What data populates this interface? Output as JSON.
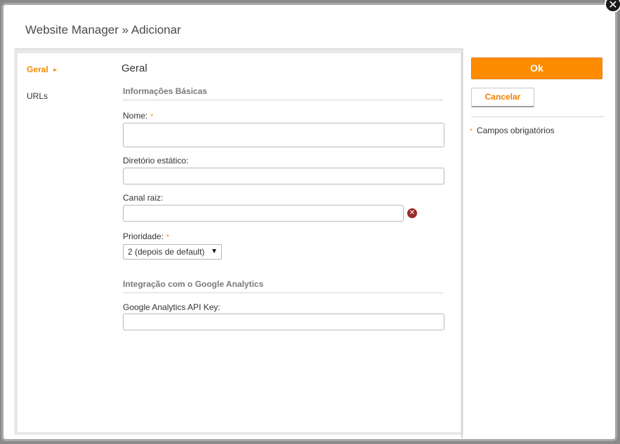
{
  "dialog": {
    "title": "Website Manager » Adicionar",
    "close_glyph": "✕"
  },
  "nav": {
    "items": [
      {
        "label": "Geral",
        "active": true
      },
      {
        "label": "URLs",
        "active": false
      }
    ],
    "active_arrow": "►"
  },
  "form": {
    "section_title": "Geral",
    "basic_info": {
      "title": "Informações Básicas",
      "name_label": "Nome:",
      "static_dir_label": "Diretório estático:",
      "root_channel_label": "Canal raiz:",
      "priority_label": "Prioridade:",
      "priority_value": "2 (depois de default)",
      "required_marker": "*"
    },
    "analytics": {
      "title": "Integração com o Google Analytics",
      "api_key_label": "Google Analytics API Key:"
    }
  },
  "actions": {
    "ok_label": "Ok",
    "cancel_label": "Cancelar"
  },
  "notes": {
    "required_fields": "Campos obrigatórios"
  },
  "colors": {
    "accent": "#ff8c00",
    "accent_text": "#f38b00",
    "clear_icon": "#9b2b2b"
  }
}
